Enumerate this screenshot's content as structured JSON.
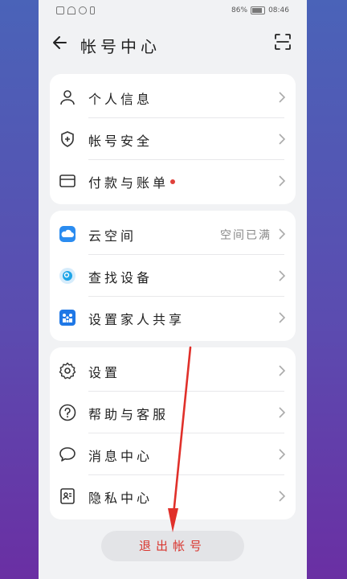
{
  "status_bar": {
    "battery": "86%",
    "time": "08:46"
  },
  "header": {
    "title": "帐号中心"
  },
  "groups": [
    {
      "items": [
        {
          "label": "个人信息",
          "icon": "person-icon"
        },
        {
          "label": "帐号安全",
          "icon": "shield-plus-icon"
        },
        {
          "label": "付款与账单",
          "icon": "card-icon",
          "badge": "red-dot"
        }
      ]
    },
    {
      "items": [
        {
          "label": "云空间",
          "icon": "cloud-app-icon",
          "value": "空间已满"
        },
        {
          "label": "查找设备",
          "icon": "find-device-app-icon"
        },
        {
          "label": "设置家人共享",
          "icon": "family-share-app-icon"
        }
      ]
    },
    {
      "items": [
        {
          "label": "设置",
          "icon": "gear-icon"
        },
        {
          "label": "帮助与客服",
          "icon": "help-icon"
        },
        {
          "label": "消息中心",
          "icon": "chat-bubble-icon"
        },
        {
          "label": "隐私中心",
          "icon": "privacy-icon"
        }
      ]
    }
  ],
  "logout_label": "退出帐号",
  "colors": {
    "accent_red": "#d9362f",
    "cloud_blue": "#2b8cf0",
    "family_blue": "#1f78e6"
  }
}
